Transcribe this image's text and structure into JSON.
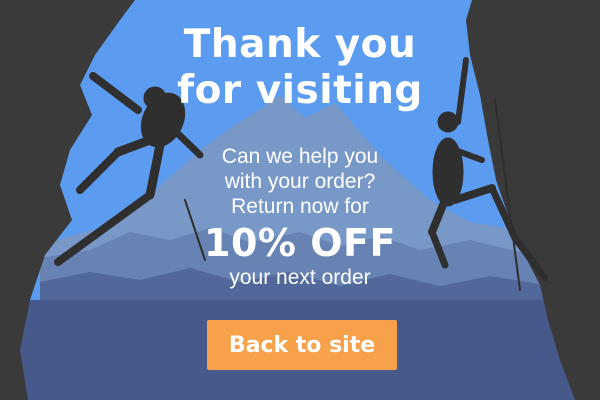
{
  "headline": {
    "line1": "Thank you",
    "line2": "for visiting"
  },
  "message": {
    "line1": "Can we help you",
    "line2": "with your order?",
    "line3": "Return now for",
    "discount": "10% OFF",
    "line4": "your next order"
  },
  "cta": {
    "label": "Back to site"
  },
  "colors": {
    "sky": "#5b9cf0",
    "cliff": "#3a3a3a",
    "button": "#f7a24b",
    "text": "#ffffff"
  }
}
